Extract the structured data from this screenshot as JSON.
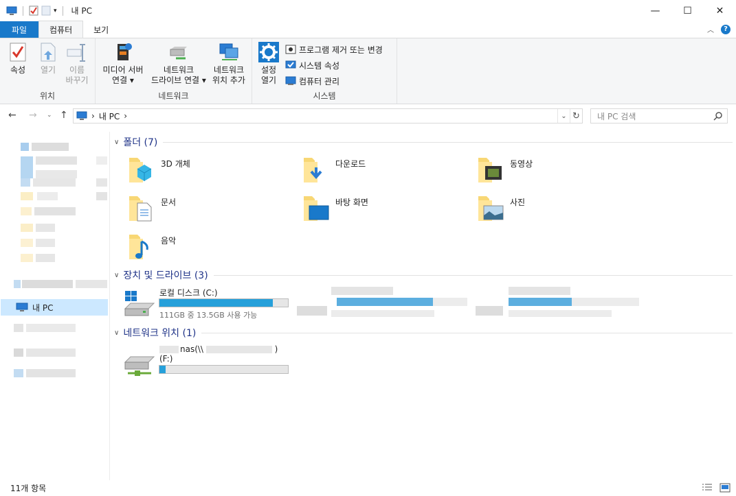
{
  "window": {
    "title": "내 PC",
    "controls": {
      "minimize": "—",
      "maximize": "☐",
      "close": "✕"
    }
  },
  "ribbon_tabs": {
    "file": "파일",
    "computer": "컴퓨터",
    "view": "보기"
  },
  "ribbon": {
    "location": {
      "label": "위치",
      "properties": "속성",
      "open": "열기",
      "rename_1": "이름",
      "rename_2": "바꾸기"
    },
    "network": {
      "label": "네트워크",
      "media_1": "미디어 서버",
      "media_2": "연결 ▾",
      "map_1": "네트워크",
      "map_2": "드라이브 연결 ▾",
      "add_1": "네트워크",
      "add_2": "위치 추가"
    },
    "system": {
      "label": "시스템",
      "settings_1": "설정",
      "settings_2": "열기",
      "uninstall": "프로그램 제거 또는 변경",
      "sysprops": "시스템 속성",
      "manage": "컴퓨터 관리"
    }
  },
  "address": {
    "path": "내 PC",
    "sep": "›",
    "search_placeholder": "내 PC 검색"
  },
  "nav": {
    "mypc": "내 PC"
  },
  "sections": {
    "folders": "폴더 (7)",
    "drives": "장치 및 드라이브 (3)",
    "network": "네트워크 위치 (1)"
  },
  "folders": [
    {
      "name": "3D 개체",
      "icon": "3d-objects-icon"
    },
    {
      "name": "다운로드",
      "icon": "downloads-icon"
    },
    {
      "name": "동영상",
      "icon": "videos-icon"
    },
    {
      "name": "문서",
      "icon": "documents-icon"
    },
    {
      "name": "바탕 화면",
      "icon": "desktop-icon"
    },
    {
      "name": "사진",
      "icon": "pictures-icon"
    },
    {
      "name": "음악",
      "icon": "music-icon"
    }
  ],
  "drives": [
    {
      "name": "로컬 디스크 (C:)",
      "free": "111GB 중 13.5GB 사용 가능",
      "used_fraction": 0.88
    }
  ],
  "network_locations": [
    {
      "name": "nas(\\\\",
      "name_end": ")",
      "letter": "(F:)",
      "used_fraction": 0.05
    }
  ],
  "status": {
    "count": "11개 항목"
  },
  "colors": {
    "accent": "#1979ca",
    "bar_fill": "#26a0da",
    "selection": "#cce8ff",
    "header": "#1e3287"
  }
}
